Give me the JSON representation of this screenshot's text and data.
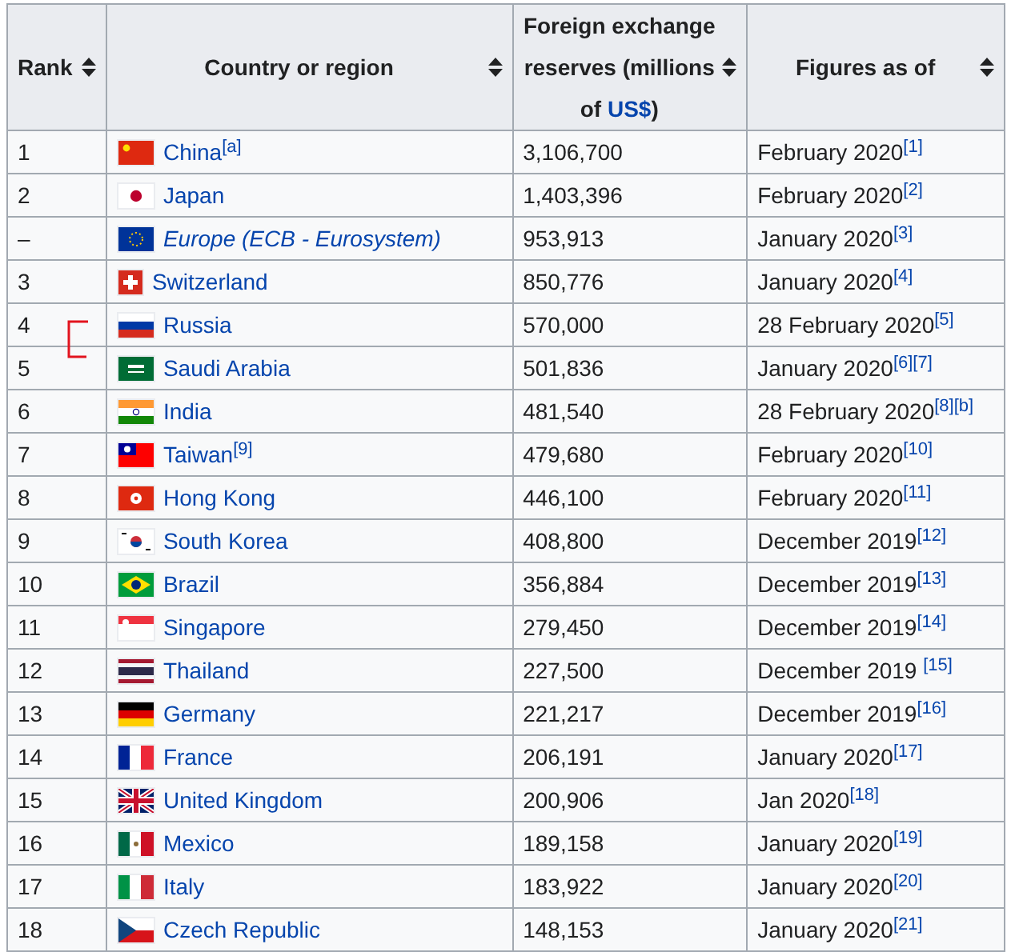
{
  "table": {
    "columns": [
      {
        "label": "Rank"
      },
      {
        "label": "Country or region"
      },
      {
        "label": "Foreign exchange reserves (millions of",
        "link": "US$",
        "suffix": ")"
      },
      {
        "label": "Figures as of"
      }
    ],
    "rows": [
      {
        "rank": "1",
        "name": "China$^{[a]}$",
        "kind": "country",
        "reserves": "3,106,700",
        "date": "February 2020$^{[1]}$"
      },
      {
        "rank": "2",
        "name": "Japan",
        "kind": "country",
        "reserves": "1,403,396",
        "date": "February 2020$^{[2]}$"
      },
      {
        "rank": "–",
        "name": "Europe (ECB - Eurosystem)",
        "kind": "region",
        "reserves": "953,913",
        "date": "January 2020$^{[3]}$"
      },
      {
        "rank": "3",
        "name": "Switzerland",
        "kind": "country",
        "reserves": "850,776",
        "date": "January 2020$^{[4]}$"
      },
      {
        "rank": "4",
        "name": "Russia",
        "kind": "country",
        "reserves": "570,000",
        "date": "28 February 2020$^{[5]}$"
      },
      {
        "rank": "5",
        "name": "Saudi Arabia",
        "kind": "country",
        "reserves": "501,836",
        "date": "January 2020$^{[6]}$$^{[7]}$"
      },
      {
        "rank": "6",
        "name": "India",
        "kind": "country",
        "reserves": "481,540",
        "date": "28 February 2020$^{[8]}$$^{[b]}$"
      },
      {
        "rank": "7",
        "name": "Taiwan$^{[9]}$",
        "kind": "country",
        "reserves": "479,680",
        "date": "February 2020$^{[10]}$"
      },
      {
        "rank": "8",
        "name": "Hong Kong",
        "kind": "country",
        "reserves": "446,100",
        "date": "February 2020$^{[11]}$"
      },
      {
        "rank": "9",
        "name": "South Korea",
        "kind": "country",
        "reserves": "408,800",
        "date": "December 2019$^{[12]}$"
      },
      {
        "rank": "10",
        "name": "Brazil",
        "kind": "country",
        "reserves": "356,884",
        "date": "December 2019$^{[13]}$"
      },
      {
        "rank": "11",
        "name": "Singapore",
        "kind": "country",
        "reserves": "279,450",
        "date": "December 2019$^{[14]}$"
      },
      {
        "rank": "12",
        "name": "Thailand",
        "kind": "country",
        "reserves": "227,500",
        "date": "December 2019 $^{[15]}$"
      },
      {
        "rank": "13",
        "name": "Germany",
        "kind": "country",
        "reserves": "221,217",
        "date": "December 2019$^{[16]}$"
      },
      {
        "rank": "14",
        "name": "France",
        "kind": "country",
        "reserves": "206,191",
        "date": "January 2020$^{[17]}$"
      },
      {
        "rank": "15",
        "name": "United Kingdom",
        "kind": "country",
        "reserves": "200,906",
        "date": "Jan 2020$^{[18]}$"
      },
      {
        "rank": "16",
        "name": "Mexico",
        "kind": "country",
        "reserves": "189,158",
        "date": "January 2020$^{[19]}$"
      },
      {
        "rank": "17",
        "name": "Italy",
        "kind": "country",
        "reserves": "183,922",
        "date": "January 2020$^{[20]}$"
      },
      {
        "rank": "18",
        "name": "Czech Republic",
        "kind": "country",
        "reserves": "148,153",
        "date": "January 2020$^{[21]}$"
      }
    ]
  }
}
